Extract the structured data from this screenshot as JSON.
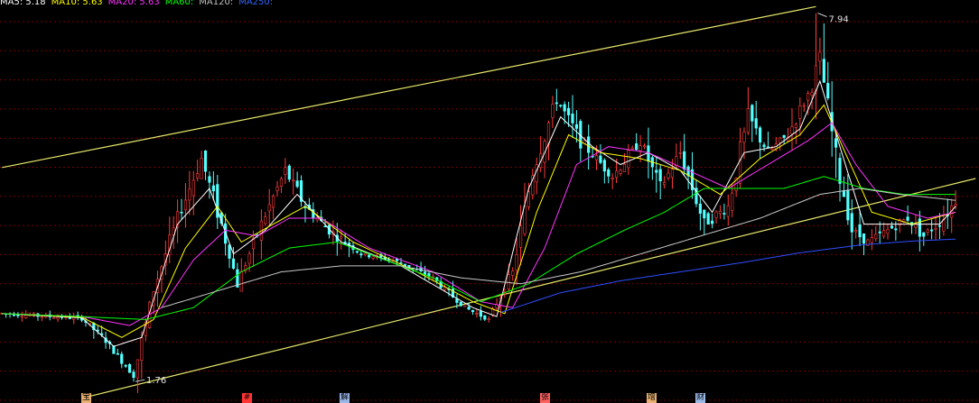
{
  "legend": [
    {
      "label": "MA5: 5.18",
      "color": "#ffffff"
    },
    {
      "label": "MA10: 5.63",
      "color": "#ffff00"
    },
    {
      "label": "MA20: 5.63",
      "color": "#ff33ff"
    },
    {
      "label": "MA60:",
      "color": "#00ff00"
    },
    {
      "label": "MA120:",
      "color": "#c0c0c0"
    },
    {
      "label": "MA250:",
      "color": "#3366ff"
    }
  ],
  "markers": [
    {
      "label": "宝",
      "color": "#e8b070"
    },
    {
      "label": "#",
      "color": "#ff3333"
    },
    {
      "label": "解",
      "color": "#9ab8e8"
    },
    {
      "label": "张",
      "color": "#ff6060"
    },
    {
      "label": "增",
      "color": "#e8b070"
    },
    {
      "label": "财",
      "color": "#9ab8e8"
    }
  ],
  "colors": {
    "up": "#ff3b3b",
    "down": "#54ffff",
    "grid": "#7a0000",
    "channel": "#e8e86a",
    "ma5": "#ffffff",
    "ma10": "#ffff00",
    "ma20": "#ff33ff",
    "ma60": "#00ff00",
    "ma120": "#c8c8c8",
    "ma250": "#2f4dff"
  },
  "chart_data": {
    "type": "candlestick",
    "y_range": [
      1.4,
      8.1
    ],
    "bars": 240,
    "annotations": {
      "high": {
        "label": "7.94",
        "value": 7.94,
        "bar_index": 204
      },
      "low": {
        "label": "1.76",
        "value": 1.76,
        "bar_index": 33
      }
    },
    "price_path": [
      [
        0,
        2.9
      ],
      [
        20,
        2.82
      ],
      [
        26,
        2.45
      ],
      [
        33,
        1.86
      ],
      [
        38,
        3.3
      ],
      [
        44,
        4.5
      ],
      [
        50,
        5.5
      ],
      [
        55,
        4.4
      ],
      [
        59,
        3.4
      ],
      [
        65,
        4.4
      ],
      [
        71,
        5.3
      ],
      [
        76,
        4.7
      ],
      [
        82,
        4.3
      ],
      [
        90,
        3.9
      ],
      [
        98,
        3.8
      ],
      [
        108,
        3.5
      ],
      [
        116,
        3.0
      ],
      [
        122,
        2.8
      ],
      [
        128,
        3.6
      ],
      [
        133,
        5.3
      ],
      [
        139,
        6.5
      ],
      [
        145,
        5.8
      ],
      [
        153,
        5.2
      ],
      [
        160,
        5.8
      ],
      [
        165,
        5.0
      ],
      [
        170,
        5.6
      ],
      [
        176,
        4.4
      ],
      [
        182,
        4.7
      ],
      [
        187,
        6.2
      ],
      [
        192,
        5.6
      ],
      [
        197,
        5.9
      ],
      [
        203,
        6.7
      ],
      [
        205,
        7.2
      ],
      [
        209,
        5.5
      ],
      [
        213,
        4.3
      ],
      [
        217,
        4.1
      ],
      [
        222,
        4.3
      ],
      [
        227,
        4.5
      ],
      [
        231,
        4.2
      ],
      [
        236,
        4.5
      ],
      [
        239,
        4.8
      ]
    ],
    "series": [
      {
        "name": "MA5",
        "values": [
          [
            0,
            2.9
          ],
          [
            20,
            2.83
          ],
          [
            28,
            2.35
          ],
          [
            35,
            2.5
          ],
          [
            44,
            4.4
          ],
          [
            52,
            5.0
          ],
          [
            58,
            3.9
          ],
          [
            66,
            4.3
          ],
          [
            74,
            4.9
          ],
          [
            85,
            4.1
          ],
          [
            100,
            3.7
          ],
          [
            118,
            3.0
          ],
          [
            124,
            2.85
          ],
          [
            132,
            5.0
          ],
          [
            140,
            6.2
          ],
          [
            148,
            5.7
          ],
          [
            155,
            5.4
          ],
          [
            162,
            5.6
          ],
          [
            170,
            5.3
          ],
          [
            178,
            4.6
          ],
          [
            186,
            5.6
          ],
          [
            194,
            5.7
          ],
          [
            200,
            6.0
          ],
          [
            205,
            6.8
          ],
          [
            210,
            5.7
          ],
          [
            216,
            4.4
          ],
          [
            225,
            4.4
          ],
          [
            235,
            4.4
          ],
          [
            239,
            4.7
          ]
        ]
      },
      {
        "name": "MA10",
        "values": [
          [
            0,
            2.9
          ],
          [
            20,
            2.84
          ],
          [
            30,
            2.5
          ],
          [
            38,
            2.8
          ],
          [
            46,
            4.0
          ],
          [
            54,
            4.7
          ],
          [
            60,
            4.1
          ],
          [
            68,
            4.4
          ],
          [
            76,
            4.7
          ],
          [
            88,
            4.1
          ],
          [
            104,
            3.6
          ],
          [
            118,
            3.1
          ],
          [
            126,
            2.9
          ],
          [
            134,
            4.6
          ],
          [
            142,
            5.9
          ],
          [
            150,
            5.6
          ],
          [
            160,
            5.5
          ],
          [
            170,
            5.3
          ],
          [
            180,
            4.9
          ],
          [
            190,
            5.5
          ],
          [
            200,
            5.9
          ],
          [
            206,
            6.4
          ],
          [
            212,
            5.5
          ],
          [
            218,
            4.6
          ],
          [
            228,
            4.4
          ],
          [
            239,
            4.6
          ]
        ]
      },
      {
        "name": "MA20",
        "values": [
          [
            0,
            2.9
          ],
          [
            20,
            2.85
          ],
          [
            32,
            2.7
          ],
          [
            40,
            3.0
          ],
          [
            48,
            3.8
          ],
          [
            56,
            4.3
          ],
          [
            64,
            4.2
          ],
          [
            72,
            4.5
          ],
          [
            80,
            4.5
          ],
          [
            92,
            4.0
          ],
          [
            108,
            3.6
          ],
          [
            120,
            3.1
          ],
          [
            128,
            3.0
          ],
          [
            136,
            4.0
          ],
          [
            144,
            5.4
          ],
          [
            152,
            5.7
          ],
          [
            162,
            5.6
          ],
          [
            172,
            5.3
          ],
          [
            182,
            5.0
          ],
          [
            192,
            5.4
          ],
          [
            202,
            5.8
          ],
          [
            208,
            6.1
          ],
          [
            214,
            5.4
          ],
          [
            222,
            4.7
          ],
          [
            232,
            4.5
          ],
          [
            239,
            4.6
          ]
        ]
      },
      {
        "name": "MA60",
        "values": [
          [
            0,
            2.9
          ],
          [
            20,
            2.85
          ],
          [
            36,
            2.8
          ],
          [
            48,
            3.0
          ],
          [
            60,
            3.6
          ],
          [
            72,
            4.0
          ],
          [
            84,
            4.1
          ],
          [
            96,
            3.8
          ],
          [
            108,
            3.5
          ],
          [
            120,
            3.1
          ],
          [
            132,
            3.4
          ],
          [
            144,
            3.9
          ],
          [
            156,
            4.3
          ],
          [
            166,
            4.6
          ],
          [
            176,
            5.0
          ],
          [
            186,
            5.0
          ],
          [
            196,
            5.0
          ],
          [
            206,
            5.2
          ],
          [
            216,
            5.0
          ],
          [
            226,
            4.9
          ],
          [
            239,
            4.9
          ]
        ]
      },
      {
        "name": "MA120",
        "values": [
          [
            40,
            3.0
          ],
          [
            55,
            3.3
          ],
          [
            70,
            3.6
          ],
          [
            85,
            3.7
          ],
          [
            100,
            3.7
          ],
          [
            115,
            3.5
          ],
          [
            130,
            3.4
          ],
          [
            145,
            3.6
          ],
          [
            160,
            3.9
          ],
          [
            175,
            4.2
          ],
          [
            190,
            4.5
          ],
          [
            205,
            4.9
          ],
          [
            215,
            5.0
          ],
          [
            225,
            4.9
          ],
          [
            239,
            4.8
          ]
        ]
      },
      {
        "name": "MA250",
        "values": [
          [
            125,
            2.92
          ],
          [
            140,
            3.25
          ],
          [
            155,
            3.45
          ],
          [
            170,
            3.6
          ],
          [
            185,
            3.75
          ],
          [
            200,
            3.92
          ],
          [
            215,
            4.05
          ],
          [
            229,
            4.12
          ],
          [
            239,
            4.15
          ]
        ]
      }
    ],
    "channel_lines": [
      {
        "name": "upper",
        "points": [
          [
            0,
            5.35
          ],
          [
            204,
            8.05
          ]
        ]
      },
      {
        "name": "lower",
        "points": [
          [
            20,
            1.48
          ],
          [
            240,
            5.1
          ]
        ]
      }
    ]
  }
}
